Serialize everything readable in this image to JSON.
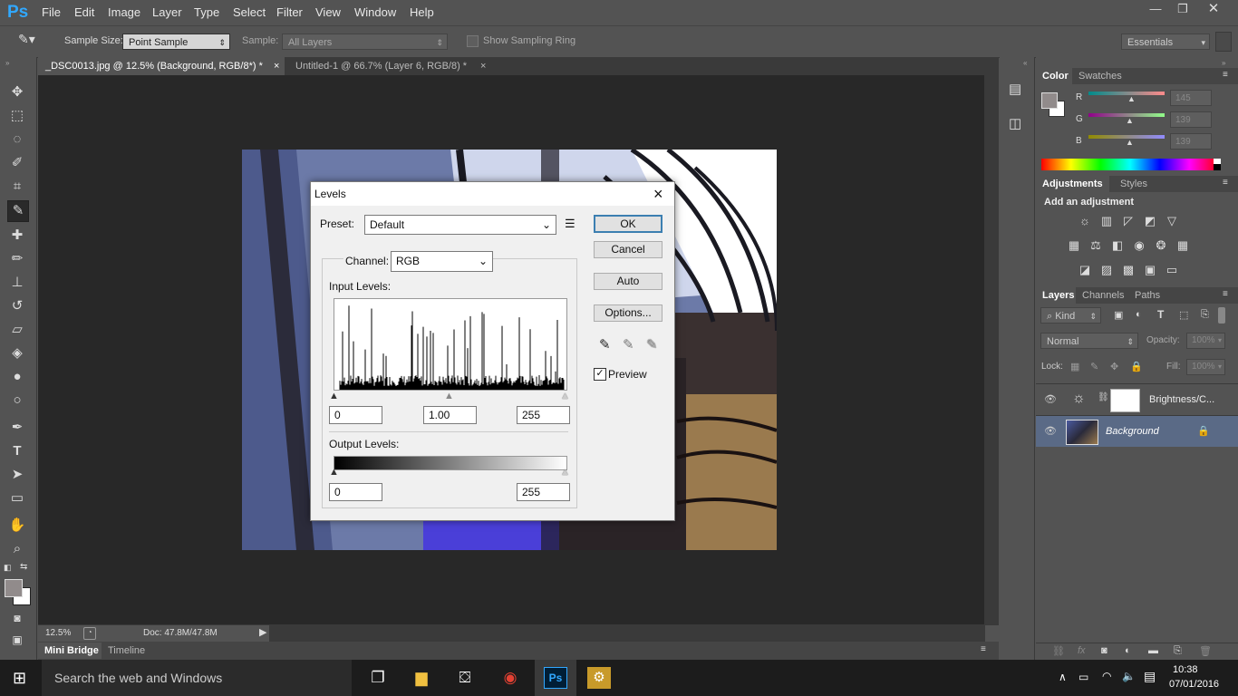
{
  "app": {
    "logo": "Ps",
    "menu": [
      "File",
      "Edit",
      "Image",
      "Layer",
      "Type",
      "Select",
      "Filter",
      "View",
      "Window",
      "Help"
    ],
    "window_controls": [
      "minimize-icon",
      "restore-icon",
      "close-icon"
    ]
  },
  "options": {
    "sample_size_label": "Sample Size:",
    "sample_size_value": "Point Sample",
    "sample_label": "Sample:",
    "sample_value": "All Layers",
    "ring_label": "Show Sampling Ring",
    "workspace": "Essentials"
  },
  "tabs": [
    {
      "label": "_DSC0013.jpg @ 12.5% (Background, RGB/8*) *",
      "close": "×"
    },
    {
      "label": "Untitled-1 @ 66.7% (Layer 6, RGB/8) *",
      "close": "×"
    }
  ],
  "status": {
    "zoom": "12.5%",
    "doc": "Doc: 47.8M/47.8M"
  },
  "bottom_tabs": [
    "Mini Bridge",
    "Timeline"
  ],
  "levels": {
    "title": "Levels",
    "preset_label": "Preset:",
    "preset_value": "Default",
    "channel_label": "Channel:",
    "channel_value": "RGB",
    "input_label": "Input Levels:",
    "input_black": "0",
    "input_gamma": "1.00",
    "input_white": "255",
    "output_label": "Output Levels:",
    "output_black": "0",
    "output_white": "255",
    "ok": "OK",
    "cancel": "Cancel",
    "auto": "Auto",
    "options": "Options...",
    "preview_label": "Preview",
    "preview_checked": true,
    "close": "×"
  },
  "color_panel": {
    "tabs": [
      "Color",
      "Swatches"
    ],
    "r_label": "R",
    "g_label": "G",
    "b_label": "B",
    "r": "145",
    "g": "139",
    "b": "139"
  },
  "adjustments": {
    "tabs": [
      "Adjustments",
      "Styles"
    ],
    "heading": "Add an adjustment"
  },
  "layers": {
    "tabs": [
      "Layers",
      "Channels",
      "Paths"
    ],
    "kind": "Kind",
    "blend": "Normal",
    "opacity_label": "Opacity:",
    "opacity": "100%",
    "lock_label": "Lock:",
    "fill_label": "Fill:",
    "fill": "100%",
    "items": [
      {
        "name": "Brightness/C..."
      },
      {
        "name": "Background"
      }
    ]
  },
  "taskbar": {
    "search": "Search the web and Windows",
    "time": "10:38",
    "date": "07/01/2016"
  }
}
